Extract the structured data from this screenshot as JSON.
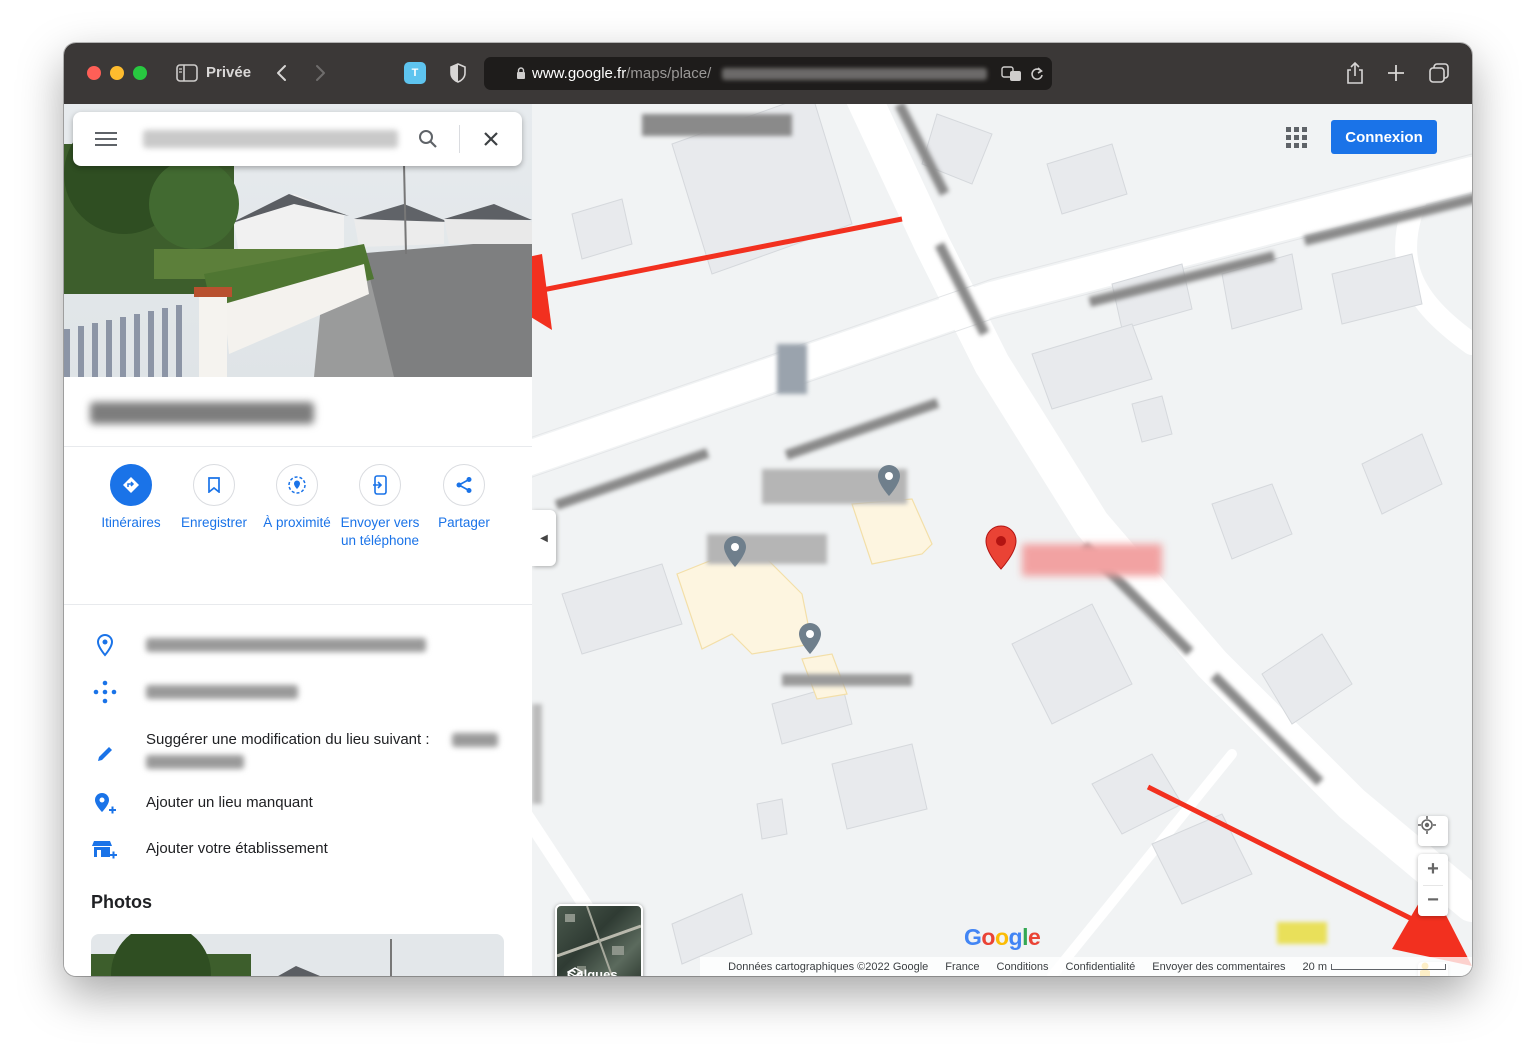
{
  "browser": {
    "private_label": "Privée",
    "url_host": "www.google.fr",
    "url_path": "/maps/place/"
  },
  "map": {
    "connexion_label": "Connexion",
    "calques_label": "Calques",
    "google_logo": "Google",
    "footer": {
      "data_credit": "Données cartographiques ©2022 Google",
      "country": "France",
      "conditions": "Conditions",
      "privacy": "Confidentialité",
      "feedback": "Envoyer des commentaires",
      "scale_label": "20 m"
    }
  },
  "actions": [
    {
      "label": "Itinéraires"
    },
    {
      "label": "Enregistrer"
    },
    {
      "label": "À proximité"
    },
    {
      "label": "Envoyer vers un téléphone"
    },
    {
      "label": "Partager"
    }
  ],
  "info": {
    "suggest_edit": "Suggérer une modification du lieu suivant :",
    "add_missing": "Ajouter un lieu manquant",
    "add_business": "Ajouter votre établissement"
  },
  "photos_title": "Photos",
  "colors": {
    "accent": "#1a73e8",
    "pin_red": "#ea4335",
    "arrow_red": "#f2301f"
  }
}
